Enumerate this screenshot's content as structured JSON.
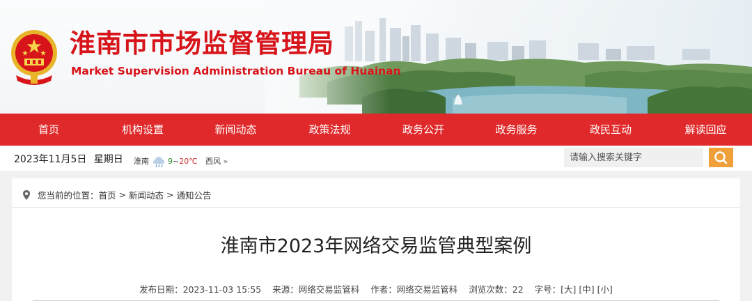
{
  "header": {
    "title": "淮南市市场监督管理局",
    "subtitle": "Market Supervision Administration Bureau of Huainan",
    "emblem_icon": "national-emblem-icon",
    "brand_color": "#d7141a"
  },
  "nav": {
    "background": "#e0292a",
    "items": [
      {
        "label": "首页"
      },
      {
        "label": "机构设置"
      },
      {
        "label": "新闻动态"
      },
      {
        "label": "政策法规"
      },
      {
        "label": "政务公开"
      },
      {
        "label": "政务服务"
      },
      {
        "label": "政民互动"
      },
      {
        "label": "解读回应"
      }
    ]
  },
  "infobar": {
    "date": "2023年11月5日",
    "weekday": "星期日",
    "weather": {
      "city": "淮南",
      "temp_low": "9",
      "temp_sep": "~",
      "temp_high": "20℃",
      "wind": "西风",
      "more": "»",
      "icon": "cloud-rain-icon"
    },
    "search": {
      "placeholder": "请输入搜索关键字",
      "button_icon": "search-icon",
      "button_color": "#f0a03a"
    }
  },
  "breadcrumb": {
    "prefix": "您当前的位置：",
    "items": [
      "首页",
      "新闻动态",
      "通知公告"
    ],
    "separator": ">",
    "icon": "location-pin-icon"
  },
  "article": {
    "title": "淮南市2023年网络交易监管典型案例",
    "date_label": "发布日期：",
    "date": "2023-11-03 15:55",
    "source_label": "来源：",
    "source": "网络交易监管科",
    "author_label": "作者：",
    "author": "网络交易监管科",
    "views_label": "浏览次数：",
    "views": "22",
    "font_label": "字号：",
    "font_large": "[大]",
    "font_medium": "[中]",
    "font_small": "[小]"
  }
}
